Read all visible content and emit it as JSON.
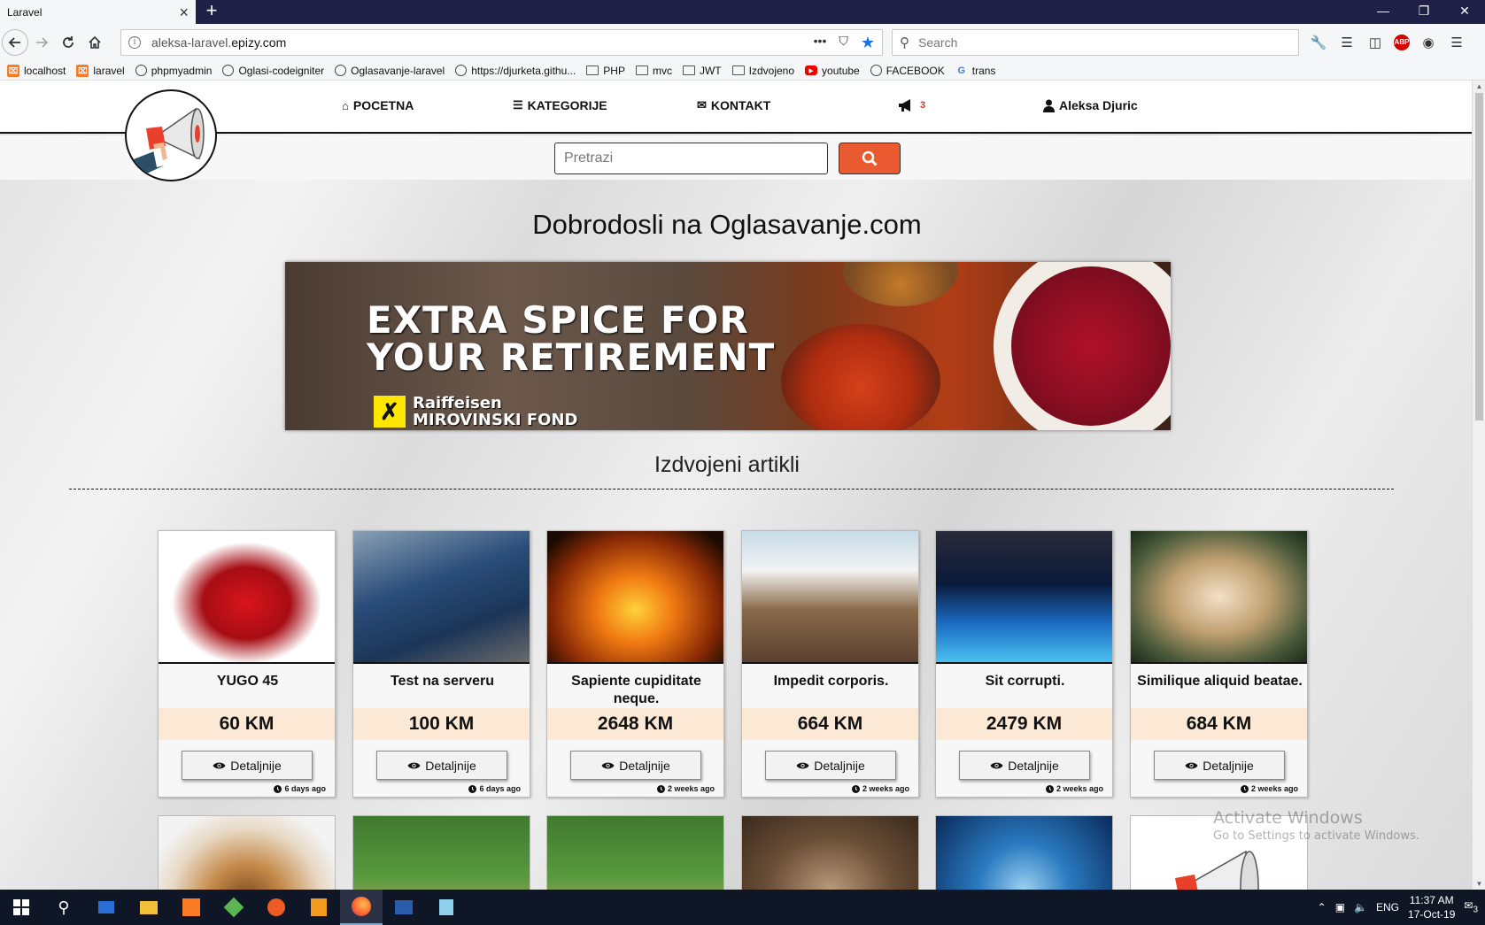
{
  "browser": {
    "tab_title": "Laravel",
    "tab_close": "×",
    "new_tab": "+",
    "window_controls": [
      "—",
      "❐",
      "✕"
    ],
    "url_prefix": "aleksa-laravel.",
    "url_domain": "epizy.com",
    "search_placeholder": "Search",
    "url_actions": [
      "•••",
      "⛉",
      "★"
    ],
    "toolbar_icons": [
      "wrench-icon",
      "library-icon",
      "sidebar-icon",
      "adblock-icon",
      "account-icon",
      "menu-icon"
    ],
    "abp_label": "ABP"
  },
  "bookmarks": [
    {
      "label": "localhost",
      "icon": "xampp"
    },
    {
      "label": "laravel",
      "icon": "xampp"
    },
    {
      "label": "phpmyadmin",
      "icon": "globe"
    },
    {
      "label": "Oglasi-codeigniter",
      "icon": "globe"
    },
    {
      "label": "Oglasavanje-laravel",
      "icon": "globe"
    },
    {
      "label": "https://djurketa.githu...",
      "icon": "globe"
    },
    {
      "label": "PHP",
      "icon": "folder"
    },
    {
      "label": "mvc",
      "icon": "folder"
    },
    {
      "label": "JWT",
      "icon": "folder"
    },
    {
      "label": "Izdvojeno",
      "icon": "folder"
    },
    {
      "label": "youtube",
      "icon": "yt"
    },
    {
      "label": "FACEBOOK",
      "icon": "globe"
    },
    {
      "label": "trans",
      "icon": "trans"
    }
  ],
  "site": {
    "menu": {
      "home": "POCETNA",
      "categories": "KATEGORIJE",
      "contact": "KONTAKT",
      "notifications_count": "3",
      "user": "Aleksa Djuric"
    },
    "search_placeholder": "Pretrazi",
    "welcome_title": "Dobrodosli na Oglasavanje.com",
    "banner": {
      "headline": "EXTRA SPICE FOR\nYOUR RETIREMENT",
      "brand": "Raiffeisen\nMIROVINSKI FOND"
    },
    "featured_heading": "Izdvojeni artikli",
    "details_label": "Detaljnije"
  },
  "cards": [
    {
      "title": "YUGO 45",
      "price": "60 KM",
      "time": "6 days ago"
    },
    {
      "title": "Test na serveru",
      "price": "100 KM",
      "time": "6 days ago"
    },
    {
      "title": "Sapiente cupiditate neque.",
      "price": "2648 KM",
      "time": "2 weeks ago"
    },
    {
      "title": "Impedit corporis.",
      "price": "664 KM",
      "time": "2 weeks ago"
    },
    {
      "title": "Sit corrupti.",
      "price": "2479 KM",
      "time": "2 weeks ago"
    },
    {
      "title": "Similique aliquid beatae.",
      "price": "684 KM",
      "time": "2 weeks ago"
    }
  ],
  "watermark": {
    "line1": "Activate Windows",
    "line2": "Go to Settings to activate Windows."
  },
  "taskbar": {
    "language": "ENG",
    "time": "11:37 AM",
    "date": "17-Oct-19",
    "notification_count": "3"
  },
  "colors": {
    "search_button": "#ea5a31",
    "price_band": "#fbe9d6",
    "notification": "#e0341a",
    "titlebar": "#1e2047"
  }
}
